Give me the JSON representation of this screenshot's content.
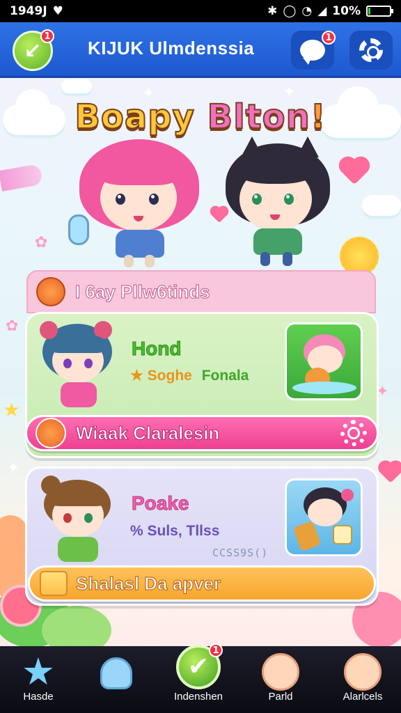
{
  "status_bar": {
    "time": "1949J",
    "battery": "10%",
    "battery_level": 0.1
  },
  "header": {
    "title": "KIJUK Ulmdenssia",
    "back_badge": "1",
    "chat_badge": "1"
  },
  "hero": {
    "title_part1": "Boapy",
    "title_part2": "Blton",
    "title_part3": "!"
  },
  "list": {
    "header_title": "I 6ay Pllw6tinds",
    "cards": [
      {
        "name": "Hond",
        "sub1": "★ Soghe",
        "sub2": "Fonala",
        "action_label": "Wiaak Claralesin"
      },
      {
        "name": "Poake",
        "sub": "% Suls, Tllss",
        "code": "CCSS9S()",
        "action_label": "Shalasl Da apver"
      }
    ]
  },
  "bottom_nav": {
    "items": [
      {
        "label": "Hasde",
        "icon": "star-icon"
      },
      {
        "label": "",
        "icon": "ghost-icon"
      },
      {
        "label": "Indenshen",
        "icon": "checkmark-icon",
        "badge": "1"
      },
      {
        "label": "Parld",
        "icon": "bear-face-icon"
      },
      {
        "label": "Alarlcels",
        "icon": "bear-face-icon"
      }
    ]
  },
  "colors": {
    "header_blue": "#2f72e6",
    "accent_pink": "#ef3f93",
    "accent_green": "#4bbf2e",
    "accent_orange": "#f7a62e"
  }
}
